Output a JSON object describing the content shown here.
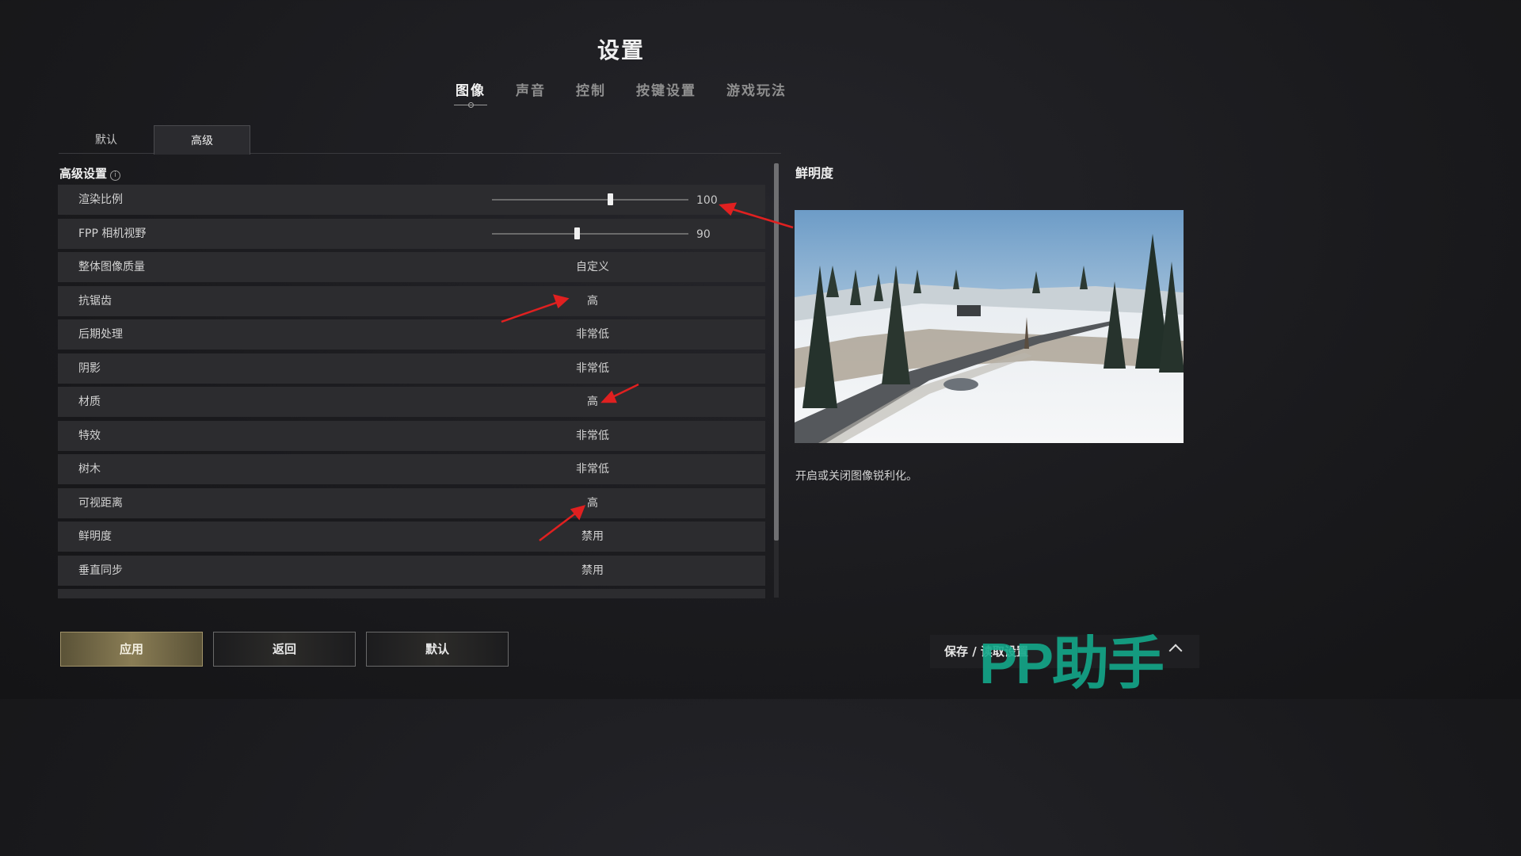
{
  "header": {
    "title": "设置"
  },
  "main_tabs": [
    {
      "label": "图像",
      "active": true
    },
    {
      "label": "声音",
      "active": false
    },
    {
      "label": "控制",
      "active": false
    },
    {
      "label": "按键设置",
      "active": false
    },
    {
      "label": "游戏玩法",
      "active": false
    }
  ],
  "sub_tabs": [
    {
      "label": "默认",
      "active": false
    },
    {
      "label": "高级",
      "active": true
    }
  ],
  "section": {
    "title": "高级设置",
    "info_icon": "info-icon"
  },
  "settings": [
    {
      "label": "渲染比例",
      "type": "slider",
      "value": "100",
      "level": 0.6
    },
    {
      "label": "FPP 相机视野",
      "type": "slider",
      "value": "90",
      "level": 0.43
    },
    {
      "label": "整体图像质量",
      "type": "select",
      "value": "自定义"
    },
    {
      "label": "抗锯齿",
      "type": "select",
      "value": "高"
    },
    {
      "label": "后期处理",
      "type": "select",
      "value": "非常低"
    },
    {
      "label": "阴影",
      "type": "select",
      "value": "非常低"
    },
    {
      "label": "材质",
      "type": "select",
      "value": "高"
    },
    {
      "label": "特效",
      "type": "select",
      "value": "非常低"
    },
    {
      "label": "树木",
      "type": "select",
      "value": "非常低"
    },
    {
      "label": "可视距离",
      "type": "select",
      "value": "高"
    },
    {
      "label": "鲜明度",
      "type": "select",
      "value": "禁用"
    },
    {
      "label": "垂直同步",
      "type": "select",
      "value": "禁用"
    }
  ],
  "detail": {
    "title": "鲜明度",
    "description": "开启或关闭图像锐利化。"
  },
  "buttons": {
    "apply": "应用",
    "back": "返回",
    "default": "默认"
  },
  "save_load": {
    "label": "保存 / 读取设置",
    "icon": "chevron-up-icon"
  },
  "watermark": "PP助手",
  "colors": {
    "apply_gold": "#8a7d55",
    "annotation_red": "#e02020",
    "watermark_green": "#13a88a"
  }
}
